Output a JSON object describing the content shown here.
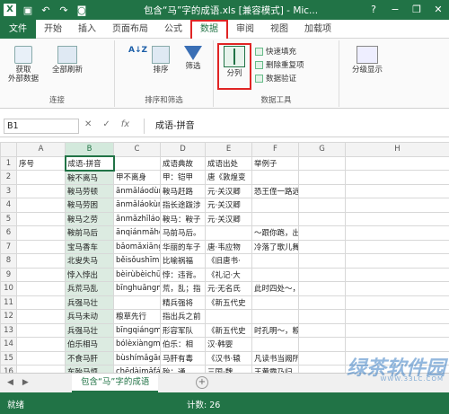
{
  "titlebar": {
    "app_icon": "X",
    "title": "包含“马”字的成语.xls [兼容模式] - Mic...",
    "help": "?",
    "minimize": "−",
    "restore": "❐",
    "close": "✕"
  },
  "tabs": [
    "文件",
    "开始",
    "插入",
    "页面布局",
    "公式",
    "数据",
    "审阅",
    "视图",
    "加载项"
  ],
  "ribbon": {
    "get_external": "获取\n外部数据",
    "refresh_all": "全部刷新",
    "group_connections": "连接",
    "sort": "排序",
    "filter": "筛选",
    "group_sort_filter": "排序和筛选",
    "text_to_columns": "分列",
    "flash_fill": "快速填充",
    "remove_duplicates": "删除重复项",
    "data_validation": "数据验证",
    "group_data_tools": "数据工具",
    "outline": "分级显示"
  },
  "formula_bar": {
    "name_box": "B1",
    "cancel": "✕",
    "enter": "✓",
    "fx": "fx",
    "value": "成语-拼音"
  },
  "grid": {
    "columns": [
      "A",
      "B",
      "C",
      "D",
      "E",
      "F",
      "G",
      "H"
    ],
    "rows": [
      [
        "序号",
        "成语-拼音",
        "",
        "成语典故",
        "成语出处",
        "举例子",
        "",
        ""
      ],
      [
        "",
        "鞍不离马",
        "甲不离身",
        "甲：铠甲",
        "唐《敦煌变",
        "",
        "",
        ""
      ],
      [
        "",
        "鞍马劳顿",
        "ānmǎláodùn",
        "鞍马赶路",
        "元·关汉卿",
        "恐王侄一路远来，～，故令王侄回营安歇",
        "",
        ""
      ],
      [
        "",
        "鞍马劳困",
        "ānmǎláokùn",
        "指长途跋涉",
        "元·关汉卿",
        "",
        "",
        ""
      ],
      [
        "",
        "鞍马之劳",
        "ānmǎzhīláo",
        "鞍马：鞍子",
        "元·关汉卿",
        "",
        "",
        ""
      ],
      [
        "",
        "鞍前马后",
        "ānqiánmǎhòu",
        "马前马后。",
        "",
        "～跟你跑，出生入死为你干。（王树元",
        "",
        ""
      ],
      [
        "",
        "宝马香车",
        "bǎomǎxiāngchē",
        "华丽的车子",
        "唐·韦应物",
        "冷落了歌儿舞女，空闲了～。（元·王实甫",
        "",
        ""
      ],
      [
        "",
        "北叟失马",
        "běisǒushīmǎ",
        "比喻祸福",
        "《旧唐书·",
        "",
        "",
        ""
      ],
      [
        "",
        "悖入悖出",
        "bèirùbèichū",
        "悖：违背。",
        "《礼记·大",
        "",
        "",
        ""
      ],
      [
        "",
        "兵荒马乱",
        "bīnghuāngmǎluàn",
        "荒，乱；指",
        "元·无名氏",
        "此时四处～，朝秦暮楚，我勉强做了一番",
        "",
        ""
      ],
      [
        "",
        "兵强马壮",
        "",
        "精兵强将",
        "《新五代史",
        "",
        "",
        ""
      ],
      [
        "",
        "兵马未动",
        "粮草先行",
        "指出兵之前",
        "",
        "",
        "",
        ""
      ],
      [
        "",
        "兵强马壮",
        "bīngqiángmǎzhuàng",
        "形容军队",
        "《新五代史",
        "时孔明～，粮草丰足，所用之物，一切完",
        "",
        ""
      ],
      [
        "",
        "伯乐相马",
        "bólèxiàngmǎ",
        "伯乐：相",
        "汉·韩婴",
        "",
        "",
        ""
      ],
      [
        "",
        "不食马肝",
        "bùshímǎgān",
        "马肝有毒",
        "《汉书·辕",
        "凡读书当阙所疑，所谓，未为不知味",
        "",
        ""
      ],
      [
        "",
        "车殆马烦",
        "chēdàimǎfán",
        "殆：通",
        "三国·魏",
        "王黄霸乃归，～，不胜困惫。（清·纪昀",
        "",
        ""
      ],
      [
        "",
        "车殆马乏",
        "chēdàimǎfá",
        "车子坏了",
        "唐·罗隐",
        "从前黄通台才过班的时候，那一天不是",
        "",
        ""
      ],
      [
        "",
        "车水马龙",
        "chēshuǐmǎlóng",
        "车象流水",
        "《后汉书",
        "～，鸟语花香",
        "",
        ""
      ]
    ],
    "row_numbers": [
      "1",
      "2",
      "3",
      "4",
      "5",
      "6",
      "7",
      "8",
      "9",
      "10",
      "11",
      "12",
      "13",
      "14",
      "15",
      "16",
      "17",
      "18"
    ]
  },
  "sheet": {
    "nav_prev": "◀",
    "nav_next": "▶",
    "tab_name": "包含“马”字的成语",
    "add": "+"
  },
  "status": {
    "ready": "就绪",
    "count": "计数: 26"
  },
  "watermark": {
    "main": "绿茶软件园",
    "sub": "WWW.33LC.COM"
  },
  "colors": {
    "excel_green": "#217346",
    "highlight_red": "#e02424"
  }
}
